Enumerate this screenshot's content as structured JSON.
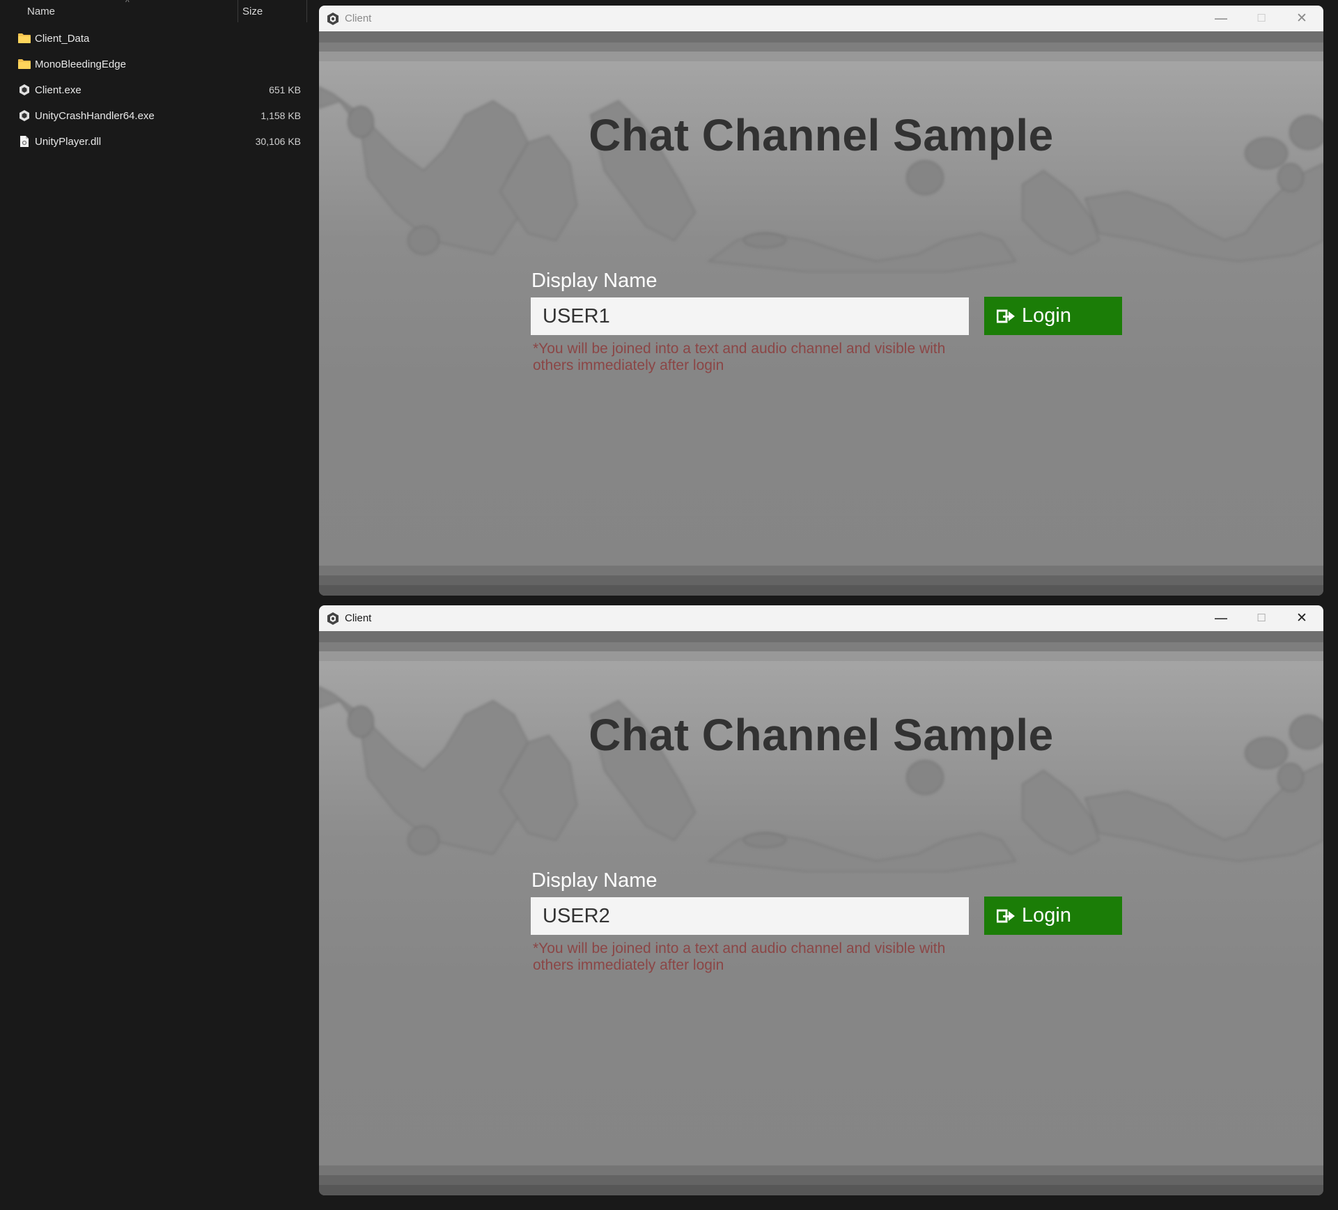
{
  "explorer": {
    "columns": {
      "name": "Name",
      "size": "Size"
    },
    "files": [
      {
        "name": "Client_Data",
        "size": "",
        "icon": "folder-icon"
      },
      {
        "name": "MonoBleedingEdge",
        "size": "",
        "icon": "folder-icon"
      },
      {
        "name": "Client.exe",
        "size": "651 KB",
        "icon": "unity-app-icon"
      },
      {
        "name": "UnityCrashHandler64.exe",
        "size": "1,158 KB",
        "icon": "unity-app-icon"
      },
      {
        "name": "UnityPlayer.dll",
        "size": "30,106 KB",
        "icon": "dll-file-icon"
      }
    ]
  },
  "windows": [
    {
      "title": "Client",
      "active": false,
      "app": {
        "title": "Chat Channel Sample",
        "field_label": "Display Name",
        "input_value": "USER1",
        "login_label": "Login",
        "notice": "*You will be joined into a text and audio channel and visible with others immediately after login"
      }
    },
    {
      "title": "Client",
      "active": true,
      "app": {
        "title": "Chat Channel Sample",
        "field_label": "Display Name",
        "input_value": "USER2",
        "login_label": "Login",
        "notice": "*You will be joined into a text and audio channel and visible with others immediately after login"
      }
    }
  ],
  "colors": {
    "login_green": "#1b7d07",
    "notice_red": "#8b4646",
    "title_dark": "#323232",
    "explorer_bg": "#191919"
  }
}
